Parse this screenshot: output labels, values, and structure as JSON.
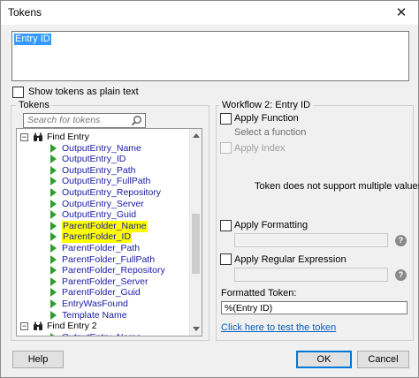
{
  "window": {
    "title": "Tokens",
    "close_glyph": "✕"
  },
  "token_editor": {
    "value": "Entry ID"
  },
  "plain_text": {
    "label": "Show tokens as plain text",
    "checked": false
  },
  "tokens_panel": {
    "title": "Tokens",
    "search_placeholder": "Search for tokens",
    "tree": [
      {
        "label": "Find Entry",
        "kind": "group",
        "expanded": true
      },
      {
        "label": "OutputEntry_Name",
        "kind": "token"
      },
      {
        "label": "OutputEntry_ID",
        "kind": "token"
      },
      {
        "label": "OutputEntry_Path",
        "kind": "token"
      },
      {
        "label": "OutputEntry_FullPath",
        "kind": "token"
      },
      {
        "label": "OutputEntry_Repository",
        "kind": "token"
      },
      {
        "label": "OutputEntry_Server",
        "kind": "token"
      },
      {
        "label": "OutputEntry_Guid",
        "kind": "token"
      },
      {
        "label": "ParentFolder_Name",
        "kind": "token",
        "highlighted": true
      },
      {
        "label": "ParentFolder_ID",
        "kind": "token",
        "highlighted": true
      },
      {
        "label": "ParentFolder_Path",
        "kind": "token"
      },
      {
        "label": "ParentFolder_FullPath",
        "kind": "token"
      },
      {
        "label": "ParentFolder_Repository",
        "kind": "token"
      },
      {
        "label": "ParentFolder_Server",
        "kind": "token"
      },
      {
        "label": "ParentFolder_Guid",
        "kind": "token"
      },
      {
        "label": "EntryWasFound",
        "kind": "token"
      },
      {
        "label": "Template Name",
        "kind": "token"
      },
      {
        "label": "Find Entry 2",
        "kind": "group",
        "expanded": true
      },
      {
        "label": "OutputEntry_Name",
        "kind": "token"
      }
    ]
  },
  "workflow_panel": {
    "title": "Workflow 2: Entry ID",
    "apply_function": {
      "label": "Apply Function",
      "checked": false
    },
    "select_function": "Select a function",
    "apply_index": {
      "label": "Apply Index",
      "checked": false,
      "enabled": false
    },
    "message": "Token does not support multiple values.",
    "apply_formatting": {
      "label": "Apply Formatting",
      "checked": false
    },
    "apply_regex": {
      "label": "Apply Regular Expression",
      "checked": false
    },
    "formatted_token_label": "Formatted Token:",
    "formatted_token_value": "%(Entry ID)",
    "test_link": "Click here to test the token",
    "help_glyph": "?"
  },
  "buttons": {
    "help": "Help",
    "ok": "OK",
    "cancel": "Cancel"
  },
  "colors": {
    "highlight": "#ffff00",
    "token_text": "#1a1aa6",
    "token_arrow": "#2e9e2e",
    "selection": "#3399ff",
    "link": "#0b5fc0"
  }
}
